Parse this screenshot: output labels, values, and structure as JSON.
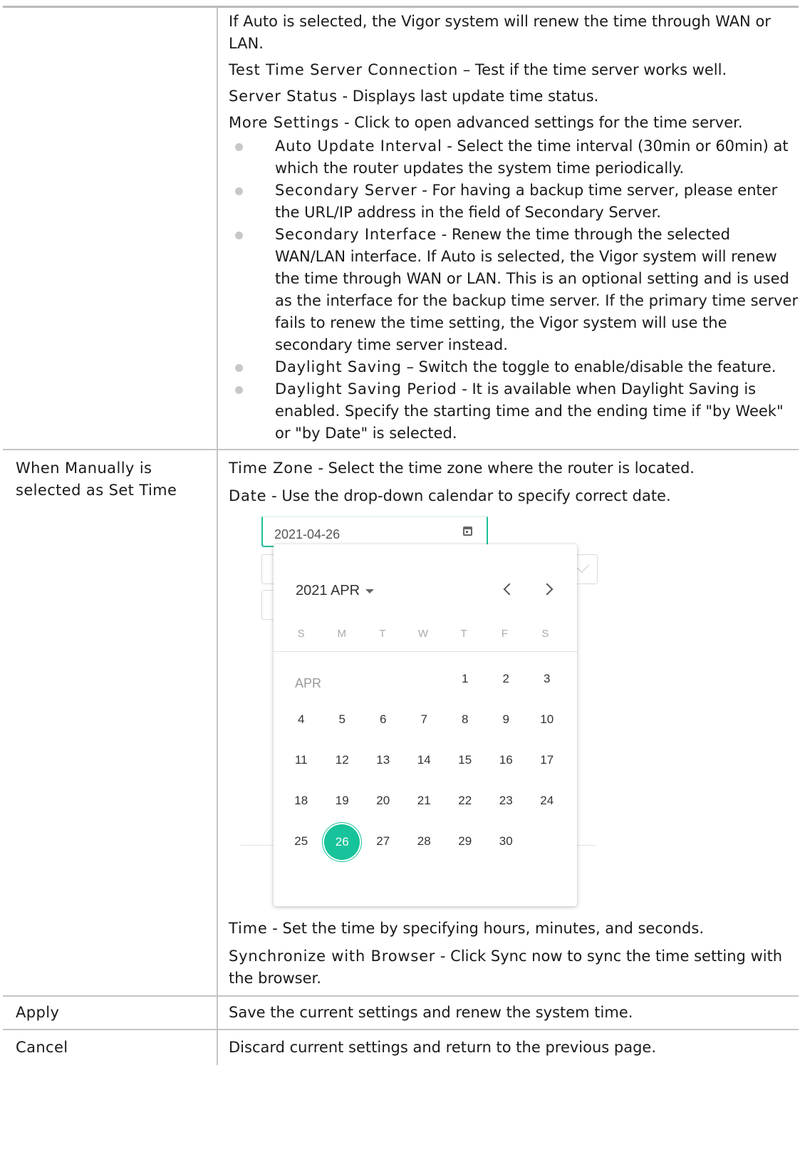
{
  "rows": [
    {
      "left": "",
      "paragraphs": [
        {
          "term": "",
          "desc": "If Auto is selected, the Vigor system will renew the time through WAN or LAN."
        },
        {
          "term": "Test Time Server Connection",
          "desc": " – Test if the time server works well."
        },
        {
          "term": "Server Status",
          "desc": " - Displays last update time status."
        },
        {
          "term": "More Settings",
          "desc": " - Click to open advanced settings for the time server."
        }
      ],
      "bullets": [
        {
          "term": "Auto Update Interval",
          "desc": " - Select the time interval (30min or 60min) at which the router updates the system time periodically."
        },
        {
          "term": "Secondary Server",
          "desc": " - For having a backup time server, please enter the URL/IP address in the field of Secondary Server."
        },
        {
          "term": "Secondary Interface",
          "desc": " - Renew the time through the selected WAN/LAN interface. If Auto is selected, the Vigor system will renew the time through WAN or LAN. This is an optional setting and is used as the interface for the backup time server. If the primary time server fails to renew the time setting, the Vigor system will use the secondary time server instead."
        },
        {
          "term": "Daylight Saving",
          "desc": " – Switch the toggle to enable/disable the feature."
        },
        {
          "term": "Daylight Saving Period",
          "desc": " - It is available when Daylight Saving is enabled. Specify the starting time and the ending time if \"by Week\" or \"by Date\" is selected."
        }
      ]
    },
    {
      "left": "When Manually is selected as Set Time",
      "paragraphs_before": [
        {
          "term": "Time Zone",
          "desc": " - Select the time zone where the router is located."
        },
        {
          "term": "Date",
          "desc": " - Use the drop-down calendar to specify correct date."
        }
      ],
      "paragraphs_after": [
        {
          "term": "Time",
          "desc": " - Set the time by specifying hours, minutes, and seconds."
        },
        {
          "term": "Synchronize with Browser",
          "desc": " - Click Sync now to sync the time setting with the browser."
        }
      ]
    },
    {
      "left": "Apply",
      "desc": "Save the current settings and renew the system time."
    },
    {
      "left": "Cancel",
      "desc": "Discard current settings and return to the previous page."
    }
  ],
  "calendar": {
    "input_value": "2021-04-26",
    "month_label": "2021 APR",
    "weekdays": [
      "S",
      "M",
      "T",
      "W",
      "T",
      "F",
      "S"
    ],
    "month_short": "APR",
    "first_weekday": 4,
    "days_in_month": 30,
    "selected_day": 26,
    "accent_color": "#17c39a",
    "icons": {
      "date_field": "calendar-icon",
      "month_menu": "caret-down-icon",
      "prev": "chevron-left-icon",
      "next": "chevron-right-icon"
    }
  }
}
